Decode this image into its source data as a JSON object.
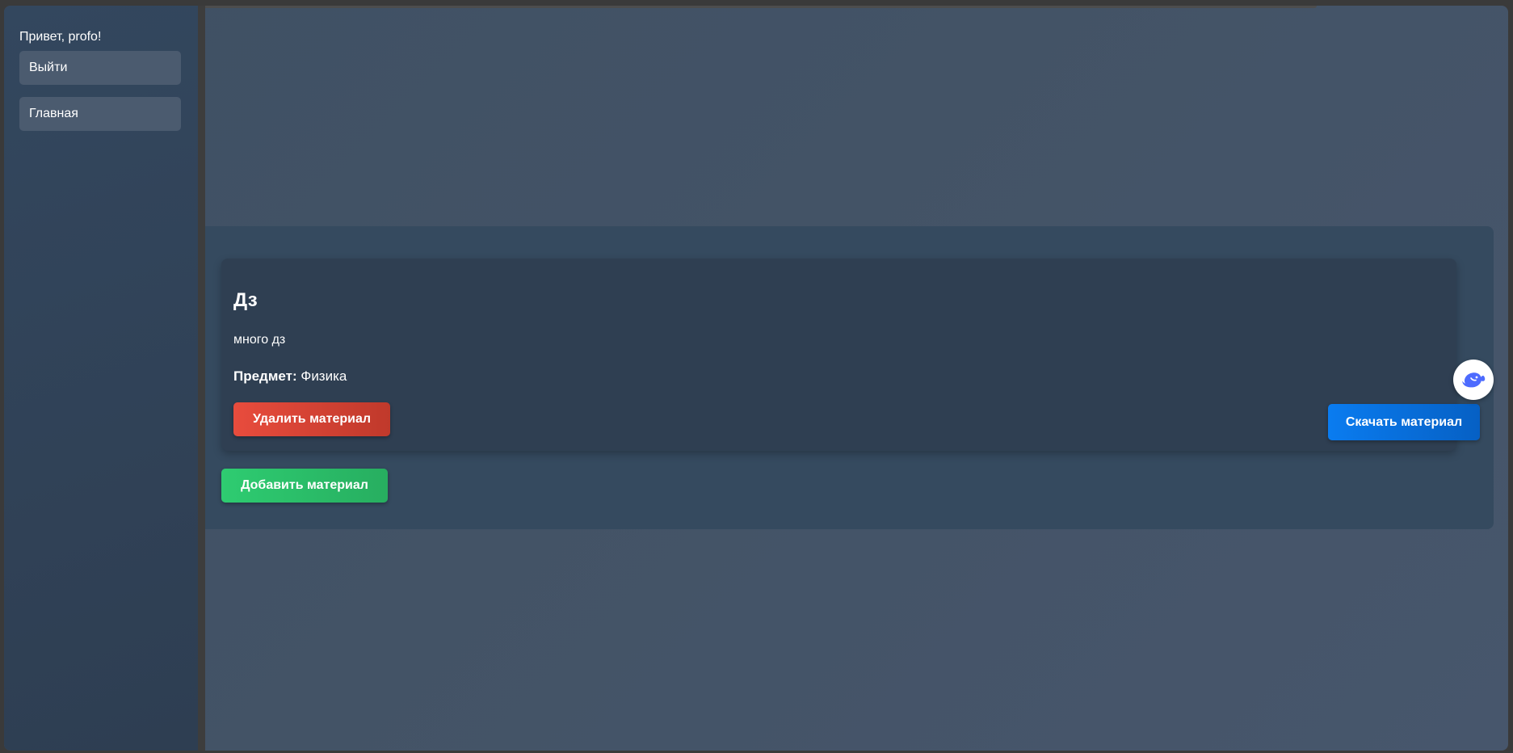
{
  "sidebar": {
    "greeting": "Привет, profo!",
    "logout_label": "Выйти",
    "home_label": "Главная"
  },
  "material": {
    "title": "Дз",
    "description": "много дз",
    "subject_label": "Предмет:",
    "subject_value": "Физика",
    "delete_label": "Удалить материал",
    "download_label": "Скачать материал"
  },
  "actions": {
    "add_label": "Добавить материал"
  },
  "floating": {
    "icon": "whale-assistant-icon"
  },
  "colors": {
    "delete": "#e74c3c",
    "download": "#0a7cf0",
    "add": "#2ecc71",
    "assistant_icon": "#4d6bfe"
  }
}
